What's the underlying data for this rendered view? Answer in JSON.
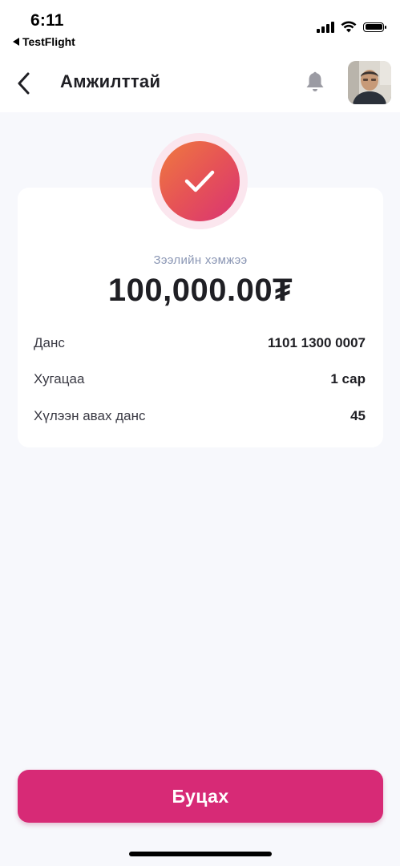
{
  "status_bar": {
    "time": "6:11",
    "back_app": "TestFlight"
  },
  "header": {
    "title": "Амжилттай",
    "back_icon": "chevron-left-icon",
    "notification_icon": "bell-icon"
  },
  "success": {
    "icon": "checkmark-icon"
  },
  "loan": {
    "amount_label": "Зээлийн хэмжээ",
    "amount": "100,000.00₮",
    "details": [
      {
        "label": "Данс",
        "value": "1101 1300 0007"
      },
      {
        "label": "Хугацаа",
        "value": "1 сар"
      },
      {
        "label": "Хүлээн авах данс",
        "value": "45"
      }
    ]
  },
  "actions": {
    "back_label": "Буцах"
  },
  "colors": {
    "accent": "#d72a76",
    "gradient_start": "#ef7a3f",
    "gradient_end": "#d93374",
    "background": "#f7f8fc"
  }
}
